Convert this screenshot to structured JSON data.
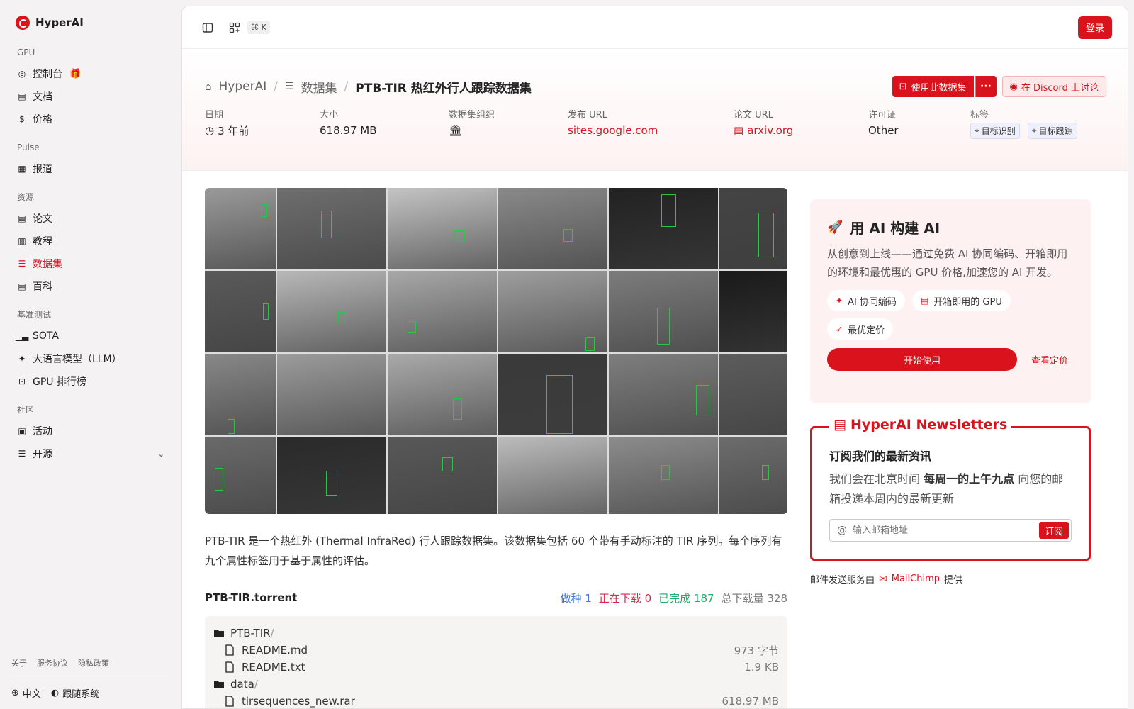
{
  "app": {
    "name": "HyperAI"
  },
  "sidebar": {
    "sections": [
      {
        "title": "GPU",
        "items": [
          {
            "label": "控制台",
            "icon": "gauge-icon"
          },
          {
            "label": "文档",
            "icon": "doc-icon"
          },
          {
            "label": "价格",
            "icon": "dollar-icon"
          }
        ]
      },
      {
        "title": "Pulse",
        "items": [
          {
            "label": "报道",
            "icon": "news-icon"
          }
        ]
      },
      {
        "title": "资源",
        "items": [
          {
            "label": "论文",
            "icon": "paper-icon"
          },
          {
            "label": "教程",
            "icon": "book-icon"
          },
          {
            "label": "数据集",
            "icon": "database-icon",
            "active": true
          },
          {
            "label": "百科",
            "icon": "encyclopedia-icon"
          }
        ]
      },
      {
        "title": "基准测试",
        "items": [
          {
            "label": "SOTA",
            "icon": "bar-chart-icon"
          },
          {
            "label": "大语言模型（LLM）",
            "icon": "sparkle-icon"
          },
          {
            "label": "GPU 排行榜",
            "icon": "chip-icon"
          }
        ]
      },
      {
        "title": "社区",
        "items": [
          {
            "label": "活动",
            "icon": "calendar-icon"
          },
          {
            "label": "开源",
            "icon": "list-icon"
          }
        ]
      }
    ],
    "footer_links": [
      "关于",
      "服务协议",
      "隐私政策"
    ],
    "language": "中文",
    "theme": "跟随系统"
  },
  "topbar": {
    "shortcut": "⌘ K",
    "login": "登录"
  },
  "breadcrumb": {
    "home": "HyperAI",
    "section": "数据集",
    "current": "PTB-TIR 热红外行人跟踪数据集"
  },
  "actions": {
    "use_dataset": "使用此数据集",
    "discord": "在 Discord 上讨论"
  },
  "meta": {
    "date_label": "日期",
    "date_value": "3 年前",
    "size_label": "大小",
    "size_value": "618.97 MB",
    "org_label": "数据集组织",
    "publish_url_label": "发布 URL",
    "publish_url_value": "sites.google.com",
    "paper_url_label": "论文 URL",
    "paper_url_value": "arxiv.org",
    "license_label": "许可证",
    "license_value": "Other",
    "tags_label": "标签",
    "tags": [
      "目标识别",
      "目标跟踪"
    ]
  },
  "description": "PTB-TIR 是一个热红外 (Thermal InfraRed) 行人跟踪数据集。该数据集包括 60 个带有手动标注的 TIR 序列。每个序列有九个属性标签用于基于属性的评估。",
  "torrent": {
    "name": "PTB-TIR.torrent",
    "seeding_label": "做种",
    "seeding": "1",
    "downloading_label": "正在下载",
    "downloading": "0",
    "completed_label": "已完成",
    "completed": "187",
    "total_label": "总下载量",
    "total": "328",
    "files": [
      {
        "name": "PTB-TIR",
        "type": "folder",
        "size": ""
      },
      {
        "name": "README.md",
        "type": "file",
        "size": "973 字节"
      },
      {
        "name": "README.txt",
        "type": "file",
        "size": "1.9 KB"
      },
      {
        "name": "data",
        "type": "folder",
        "size": ""
      },
      {
        "name": "tirsequences_new.rar",
        "type": "file",
        "size": "618.97 MB"
      }
    ]
  },
  "promo": {
    "title": "用 AI 构建 AI",
    "text": "从创意到上线——通过免费 AI 协同编码、开箱即用的环境和最优惠的 GPU 价格,加速您的 AI 开发。",
    "pills": [
      "AI 协同编码",
      "开箱即用的 GPU",
      "最优定价"
    ],
    "start": "开始使用",
    "pricing": "查看定价"
  },
  "newsletter": {
    "title": "HyperAI Newsletters",
    "heading": "订阅我们的最新资讯",
    "text_before": "我们会在北京时间",
    "text_bold": "每周一的上午九点",
    "text_after": "向您的邮箱投递本周内的最新更新",
    "placeholder": "输入邮箱地址",
    "subscribe": "订阅",
    "note_before": "邮件发送服务由",
    "note_brand": "MailChimp",
    "note_after": "提供"
  },
  "colors": {
    "accent": "#d9121c",
    "seeding": "#3b74e0",
    "downloading": "#e0244c",
    "completed": "#1dae6a"
  }
}
